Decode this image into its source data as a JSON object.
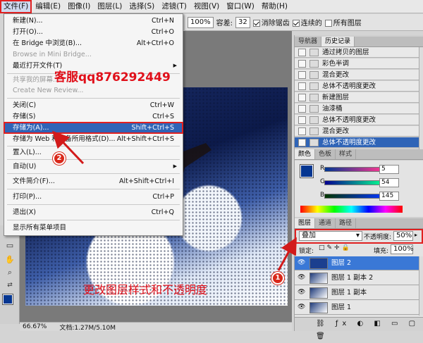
{
  "menubar": {
    "items": [
      "文件(F)",
      "编辑(E)",
      "图像(I)",
      "图层(L)",
      "选择(S)",
      "滤镜(T)",
      "视图(V)",
      "窗口(W)",
      "帮助(H)"
    ]
  },
  "options": {
    "zoom": "100%",
    "tolerance_label": "容差:",
    "tolerance_value": "32",
    "antialias_label": "消除锯齿",
    "contiguous_label": "连续的",
    "all_layers_label": "所有图层"
  },
  "file_menu": [
    {
      "label": "新建(N)...",
      "shortcut": "Ctrl+N"
    },
    {
      "label": "打开(O)...",
      "shortcut": "Ctrl+O"
    },
    {
      "label": "在 Bridge 中浏览(B)...",
      "shortcut": "Alt+Ctrl+O"
    },
    {
      "label": "Browse in Mini Bridge...",
      "shortcut": ""
    },
    {
      "label": "最近打开文件(T)",
      "shortcut": ""
    },
    {
      "label": "共享我的屏幕...",
      "shortcut": ""
    },
    {
      "label": "Create New Review...",
      "shortcut": ""
    },
    {
      "label": "关闭(C)",
      "shortcut": "Ctrl+W"
    },
    {
      "label": "存储(S)",
      "shortcut": "Ctrl+S"
    },
    {
      "label": "存储为(A)...",
      "shortcut": "Shift+Ctrl+S"
    },
    {
      "label": "存储为 Web 和设备所用格式(D)...",
      "shortcut": "Alt+Shift+Ctrl+S"
    },
    {
      "label": "置入(L)...",
      "shortcut": ""
    },
    {
      "label": "自动(U)",
      "shortcut": ""
    },
    {
      "label": "文件简介(F)...",
      "shortcut": "Alt+Shift+Ctrl+I"
    },
    {
      "label": "打印(P)...",
      "shortcut": "Ctrl+P"
    },
    {
      "label": "退出(X)",
      "shortcut": "Ctrl+Q"
    },
    {
      "label": "显示所有菜单项目",
      "shortcut": ""
    }
  ],
  "watermark": "客服qq876292449",
  "annotation": {
    "caption": "更改图层样式和不透明度",
    "badge1": "1",
    "badge2": "2"
  },
  "history": {
    "tabs": [
      "导航器",
      "历史记录"
    ],
    "items": [
      "通过拷贝的图层",
      "彩色半调",
      "混合更改",
      "总体不透明度更改",
      "新建图层",
      "油漆桶",
      "总体不透明度更改",
      "混合更改",
      "总体不透明度更改"
    ]
  },
  "color": {
    "tabs": [
      "颜色",
      "色板",
      "样式"
    ],
    "channels": [
      {
        "name": "R",
        "value": "5"
      },
      {
        "name": "G",
        "value": "54"
      },
      {
        "name": "B",
        "value": "145"
      }
    ],
    "foreground": "#053691"
  },
  "layers": {
    "tabs": [
      "图层",
      "通道",
      "路径"
    ],
    "blend_mode": "叠加",
    "opacity_label": "不透明度:",
    "opacity_value": "50%",
    "lock_label": "锁定:",
    "fill_label": "填充:",
    "fill_value": "100%",
    "items": [
      "图层 2",
      "图层 1 副本 2",
      "图层 1 副本",
      "图层 1"
    ]
  },
  "status": {
    "zoom": "66.67%",
    "doc": "文档:1.27M/5.10M"
  }
}
